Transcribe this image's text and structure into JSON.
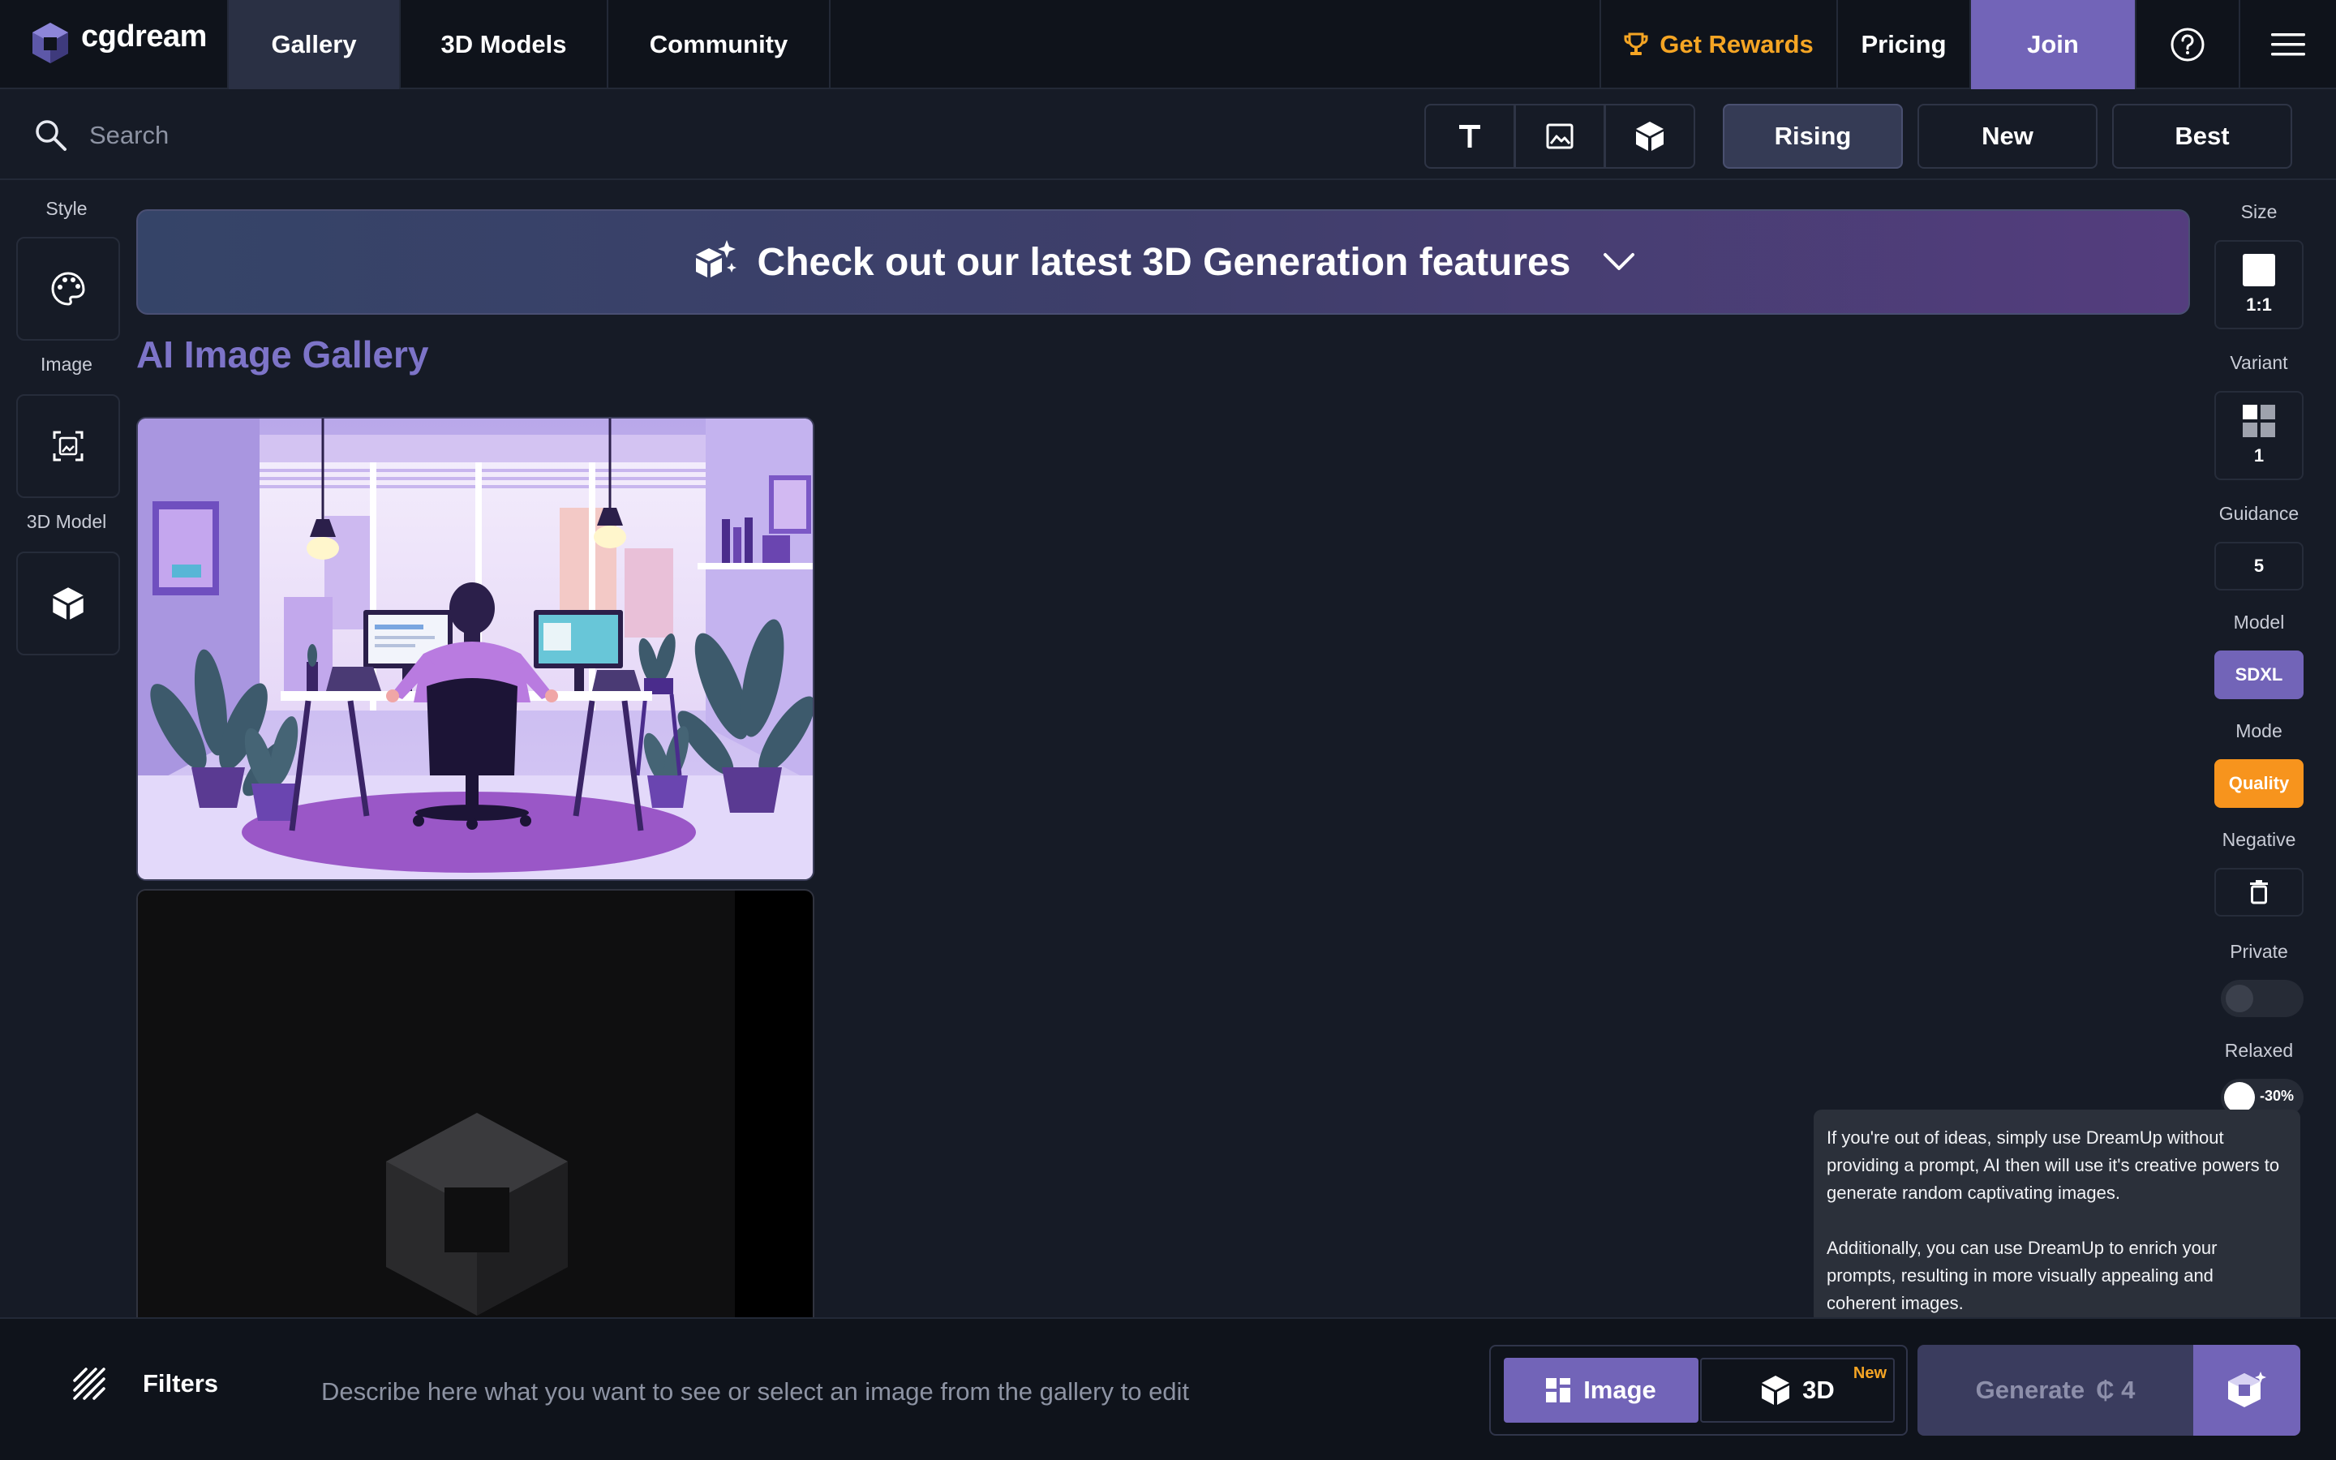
{
  "brand": {
    "name": "cgdream"
  },
  "nav": {
    "tabs": [
      {
        "label": "Gallery",
        "active": true
      },
      {
        "label": "3D Models",
        "active": false
      },
      {
        "label": "Community",
        "active": false
      }
    ],
    "rewards_label": "Get Rewards",
    "pricing_label": "Pricing",
    "join_label": "Join"
  },
  "search": {
    "placeholder": "Search",
    "type_filters": [
      "text-icon",
      "image-icon",
      "cube-icon"
    ],
    "sort": [
      {
        "label": "Rising",
        "active": true
      },
      {
        "label": "New",
        "active": false
      },
      {
        "label": "Best",
        "active": false
      }
    ]
  },
  "left_rail": {
    "style_label": "Style",
    "image_label": "Image",
    "model3d_label": "3D Model"
  },
  "right_rail": {
    "size_label": "Size",
    "size_value": "1:1",
    "variant_label": "Variant",
    "variant_value": "1",
    "guidance_label": "Guidance",
    "guidance_value": "5",
    "model_label": "Model",
    "model_value": "SDXL",
    "mode_label": "Mode",
    "mode_value": "Quality",
    "negative_label": "Negative",
    "private_label": "Private",
    "private_on": false,
    "relaxed_label": "Relaxed",
    "relaxed_discount": "-30%"
  },
  "banner": {
    "text": "Check out our latest 3D Generation features"
  },
  "gallery": {
    "title": "AI Image Gallery"
  },
  "tooltip": {
    "paragraph1": "If you're out of ideas, simply use DreamUp without providing a prompt, AI then will use it's creative powers to generate random captivating images.",
    "paragraph2": "Additionally, you can use DreamUp to enrich your prompts, resulting in more visually appealing and coherent images."
  },
  "bottom": {
    "filters_label": "Filters",
    "prompt_placeholder": "Describe here what you want to see or select an image from the gallery to edit",
    "mode_image_label": "Image",
    "mode_3d_label": "3D",
    "new_badge": "New",
    "generate_label": "Generate",
    "generate_cost": "₵ 4"
  },
  "colors": {
    "accent": "#7264b8",
    "rewards": "#f5a524",
    "quality": "#f7941d",
    "background": "#161b26"
  }
}
